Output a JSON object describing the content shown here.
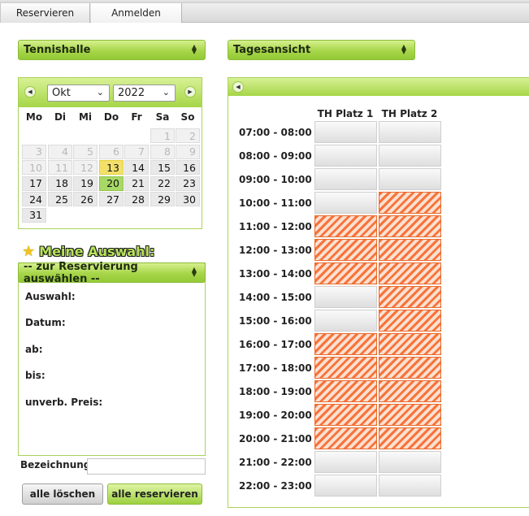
{
  "tabs": [
    {
      "label": "Reservieren"
    },
    {
      "label": "Anmelden"
    }
  ],
  "facility_select": {
    "value": "Tennishalle"
  },
  "view_select": {
    "value": "Tagesansicht"
  },
  "calendar": {
    "month": "Okt",
    "year": "2022",
    "weekdays": [
      "Mo",
      "Di",
      "Mi",
      "Do",
      "Fr",
      "Sa",
      "So"
    ],
    "rows": [
      [
        {
          "d": "",
          "s": "empty"
        },
        {
          "d": "",
          "s": "empty"
        },
        {
          "d": "",
          "s": "empty"
        },
        {
          "d": "",
          "s": "empty"
        },
        {
          "d": "",
          "s": "empty"
        },
        {
          "d": "1",
          "s": "dim"
        },
        {
          "d": "2",
          "s": "dim"
        }
      ],
      [
        {
          "d": "3",
          "s": "dim"
        },
        {
          "d": "4",
          "s": "dim"
        },
        {
          "d": "5",
          "s": "dim"
        },
        {
          "d": "6",
          "s": "dim"
        },
        {
          "d": "7",
          "s": "dim"
        },
        {
          "d": "8",
          "s": "dim"
        },
        {
          "d": "9",
          "s": "dim"
        }
      ],
      [
        {
          "d": "10",
          "s": "dim"
        },
        {
          "d": "11",
          "s": "dim"
        },
        {
          "d": "12",
          "s": "dim"
        },
        {
          "d": "13",
          "s": "today"
        },
        {
          "d": "14",
          "s": "normal"
        },
        {
          "d": "15",
          "s": "normal"
        },
        {
          "d": "16",
          "s": "normal"
        }
      ],
      [
        {
          "d": "17",
          "s": "normal"
        },
        {
          "d": "18",
          "s": "normal"
        },
        {
          "d": "19",
          "s": "normal"
        },
        {
          "d": "20",
          "s": "sel"
        },
        {
          "d": "21",
          "s": "normal"
        },
        {
          "d": "22",
          "s": "normal"
        },
        {
          "d": "23",
          "s": "normal"
        }
      ],
      [
        {
          "d": "24",
          "s": "normal"
        },
        {
          "d": "25",
          "s": "normal"
        },
        {
          "d": "26",
          "s": "normal"
        },
        {
          "d": "27",
          "s": "normal"
        },
        {
          "d": "28",
          "s": "normal"
        },
        {
          "d": "29",
          "s": "normal"
        },
        {
          "d": "30",
          "s": "normal"
        }
      ],
      [
        {
          "d": "31",
          "s": "normal"
        },
        {
          "d": "",
          "s": "empty"
        },
        {
          "d": "",
          "s": "empty"
        },
        {
          "d": "",
          "s": "empty"
        },
        {
          "d": "",
          "s": "empty"
        },
        {
          "d": "",
          "s": "empty"
        },
        {
          "d": "",
          "s": "empty"
        }
      ]
    ]
  },
  "my_selection": {
    "title": "Meine Auswahl:",
    "reservation_select": "-- zur Reservierung auswählen --",
    "fields": [
      "Auswahl:",
      "Datum:",
      "ab:",
      "bis:",
      "unverb. Preis:"
    ]
  },
  "designation_label": "Bezeichnung:",
  "buttons": {
    "clear_all": "alle löschen",
    "reserve_all": "alle reservieren"
  },
  "schedule": {
    "courts": [
      "TH Platz 1",
      "TH Platz 2"
    ],
    "slots": [
      {
        "time": "07:00 - 08:00",
        "booked": [
          false,
          false
        ]
      },
      {
        "time": "08:00 - 09:00",
        "booked": [
          false,
          false
        ]
      },
      {
        "time": "09:00 - 10:00",
        "booked": [
          false,
          false
        ]
      },
      {
        "time": "10:00 - 11:00",
        "booked": [
          false,
          true
        ]
      },
      {
        "time": "11:00 - 12:00",
        "booked": [
          true,
          true
        ]
      },
      {
        "time": "12:00 - 13:00",
        "booked": [
          true,
          true
        ]
      },
      {
        "time": "13:00 - 14:00",
        "booked": [
          true,
          true
        ]
      },
      {
        "time": "14:00 - 15:00",
        "booked": [
          false,
          true
        ]
      },
      {
        "time": "15:00 - 16:00",
        "booked": [
          false,
          true
        ]
      },
      {
        "time": "16:00 - 17:00",
        "booked": [
          true,
          true
        ]
      },
      {
        "time": "17:00 - 18:00",
        "booked": [
          true,
          true
        ]
      },
      {
        "time": "18:00 - 19:00",
        "booked": [
          true,
          true
        ]
      },
      {
        "time": "19:00 - 20:00",
        "booked": [
          true,
          true
        ]
      },
      {
        "time": "20:00 - 21:00",
        "booked": [
          true,
          true
        ]
      },
      {
        "time": "21:00 - 22:00",
        "booked": [
          false,
          false
        ]
      },
      {
        "time": "22:00 - 23:00",
        "booked": [
          false,
          false
        ]
      }
    ]
  },
  "colors": {
    "accent_green": "#a5d547",
    "booked_orange": "#f7743a",
    "today_yellow": "#f3e06a"
  }
}
